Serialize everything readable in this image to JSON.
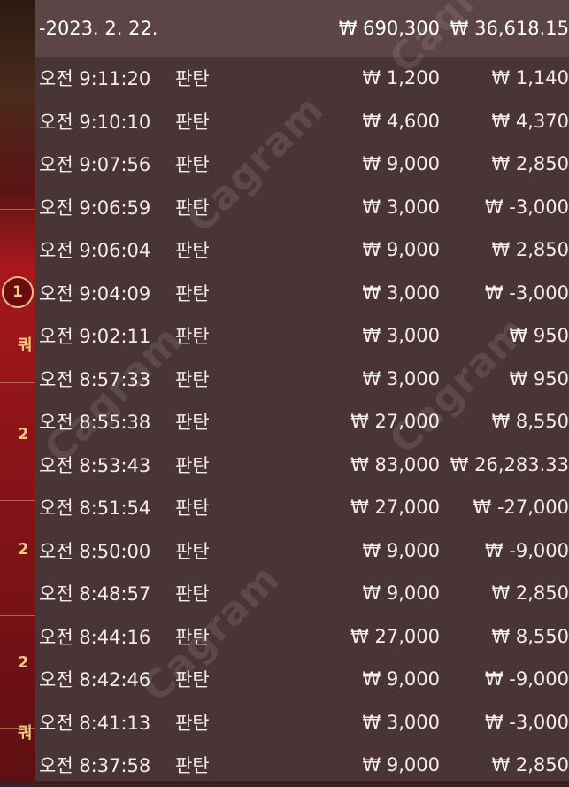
{
  "summary": {
    "date": "-2023. 2. 22.",
    "total_bet": "₩ 690,300",
    "total_pl": "₩ 36,618.15"
  },
  "colors": {
    "panel_bg": "#4a3536",
    "summary_bg": "#5b4547",
    "text": "#f2ecec",
    "table_red": "#a8181c",
    "gold": "#e6c27c"
  },
  "background": {
    "round_badge": "1",
    "edge_labels": [
      "쿼",
      "2",
      "2",
      "2",
      "쿼"
    ]
  },
  "watermark": "Cagram",
  "rows": [
    {
      "time": "오전 9:11:20",
      "type": "판탄",
      "bet": "₩ 1,200",
      "pl": "₩ 1,140"
    },
    {
      "time": "오전 9:10:10",
      "type": "판탄",
      "bet": "₩ 4,600",
      "pl": "₩ 4,370"
    },
    {
      "time": "오전 9:07:56",
      "type": "판탄",
      "bet": "₩ 9,000",
      "pl": "₩ 2,850"
    },
    {
      "time": "오전 9:06:59",
      "type": "판탄",
      "bet": "₩ 3,000",
      "pl": "₩ -3,000"
    },
    {
      "time": "오전 9:06:04",
      "type": "판탄",
      "bet": "₩ 9,000",
      "pl": "₩ 2,850"
    },
    {
      "time": "오전 9:04:09",
      "type": "판탄",
      "bet": "₩ 3,000",
      "pl": "₩ -3,000"
    },
    {
      "time": "오전 9:02:11",
      "type": "판탄",
      "bet": "₩ 3,000",
      "pl": "₩ 950"
    },
    {
      "time": "오전 8:57:33",
      "type": "판탄",
      "bet": "₩ 3,000",
      "pl": "₩ 950"
    },
    {
      "time": "오전 8:55:38",
      "type": "판탄",
      "bet": "₩ 27,000",
      "pl": "₩ 8,550"
    },
    {
      "time": "오전 8:53:43",
      "type": "판탄",
      "bet": "₩ 83,000",
      "pl": "₩ 26,283.33"
    },
    {
      "time": "오전 8:51:54",
      "type": "판탄",
      "bet": "₩ 27,000",
      "pl": "₩ -27,000"
    },
    {
      "time": "오전 8:50:00",
      "type": "판탄",
      "bet": "₩ 9,000",
      "pl": "₩ -9,000"
    },
    {
      "time": "오전 8:48:57",
      "type": "판탄",
      "bet": "₩ 9,000",
      "pl": "₩ 2,850"
    },
    {
      "time": "오전 8:44:16",
      "type": "판탄",
      "bet": "₩ 27,000",
      "pl": "₩ 8,550"
    },
    {
      "time": "오전 8:42:46",
      "type": "판탄",
      "bet": "₩ 9,000",
      "pl": "₩ -9,000"
    },
    {
      "time": "오전 8:41:13",
      "type": "판탄",
      "bet": "₩ 3,000",
      "pl": "₩ -3,000"
    },
    {
      "time": "오전 8:37:58",
      "type": "판탄",
      "bet": "₩ 9,000",
      "pl": "₩ 2,850"
    }
  ]
}
